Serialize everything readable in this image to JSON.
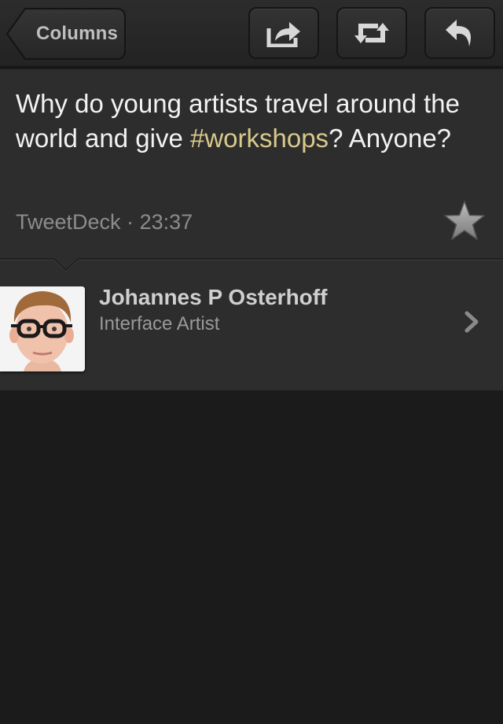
{
  "toolbar": {
    "back_label": "Columns",
    "actions": [
      {
        "name": "share",
        "icon": "share-icon"
      },
      {
        "name": "retweet",
        "icon": "retweet-icon"
      },
      {
        "name": "reply",
        "icon": "reply-icon"
      }
    ]
  },
  "tweet": {
    "text_before": "Why do young artists travel around the world and give ",
    "hashtag": "#workshops",
    "text_after": "? Anyone?",
    "source": "TweetDeck",
    "separator": "·",
    "time": "23:37",
    "favorite_icon": "star-icon"
  },
  "author": {
    "name": "Johannes P Osterhoff",
    "bio": "Interface Artist",
    "avatar_icon": "avatar-photo",
    "chevron_icon": "chevron-right-icon"
  },
  "colors": {
    "background": "#1b1b1b",
    "panel": "#2d2d2d",
    "hashtag": "#d9c98a",
    "meta_text": "#8c8c8c"
  }
}
